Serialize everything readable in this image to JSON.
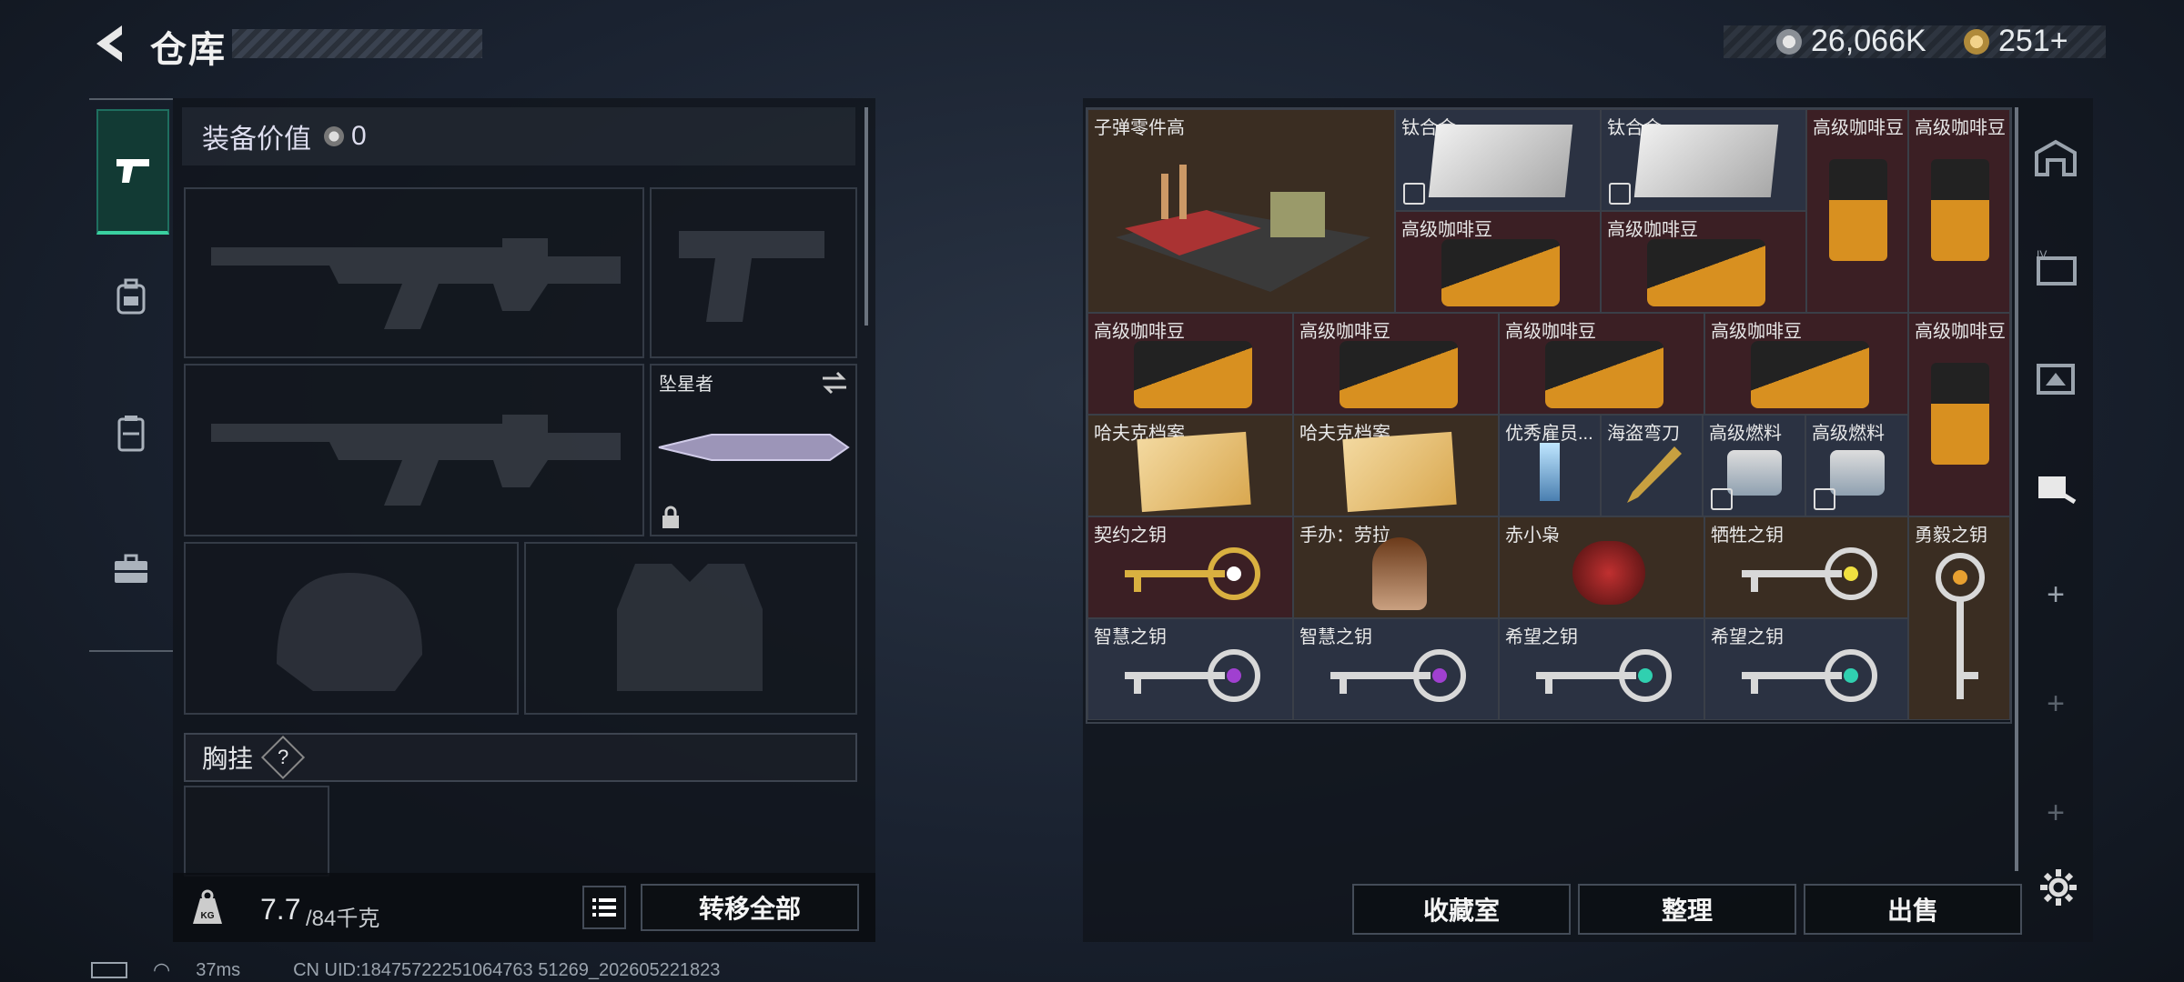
{
  "header": {
    "title": "仓库",
    "currency1": "26,066K",
    "currency2": "251+"
  },
  "left": {
    "value_label": "装备价值",
    "value": "0",
    "knife_name": "坠星者",
    "chest_label": "胸挂",
    "chest_hint": "?",
    "weight_current": "7.7",
    "weight_max": "/84千克",
    "transfer_all": "转移全部"
  },
  "inventory": {
    "items": [
      {
        "name": "子弹零件高"
      },
      {
        "name": "钛合金"
      },
      {
        "name": "钛合金"
      },
      {
        "name": "高级咖啡豆"
      },
      {
        "name": "高级咖啡豆"
      },
      {
        "name": "高级咖啡豆"
      },
      {
        "name": "高级咖啡豆"
      },
      {
        "name": "高级咖啡豆"
      },
      {
        "name": "高级咖啡豆"
      },
      {
        "name": "高级咖啡豆"
      },
      {
        "name": "高级咖啡豆"
      },
      {
        "name": "高级咖啡豆"
      },
      {
        "name": "哈夫克档案"
      },
      {
        "name": "哈夫克档案"
      },
      {
        "name": "优秀雇员..."
      },
      {
        "name": "海盗弯刀"
      },
      {
        "name": "高级燃料"
      },
      {
        "name": "高级燃料"
      },
      {
        "name": "契约之钥"
      },
      {
        "name": "手办：劳拉"
      },
      {
        "name": "赤小枭"
      },
      {
        "name": "牺牲之钥"
      },
      {
        "name": "勇毅之钥"
      },
      {
        "name": "智慧之钥"
      },
      {
        "name": "智慧之钥"
      },
      {
        "name": "希望之钥"
      },
      {
        "name": "希望之钥"
      }
    ]
  },
  "buttons": {
    "collection": "收藏室",
    "sort": "整理",
    "sell": "出售"
  },
  "status": {
    "ping": "37ms",
    "uid": "CN UID:18475722251064763 51269_202605221823"
  }
}
